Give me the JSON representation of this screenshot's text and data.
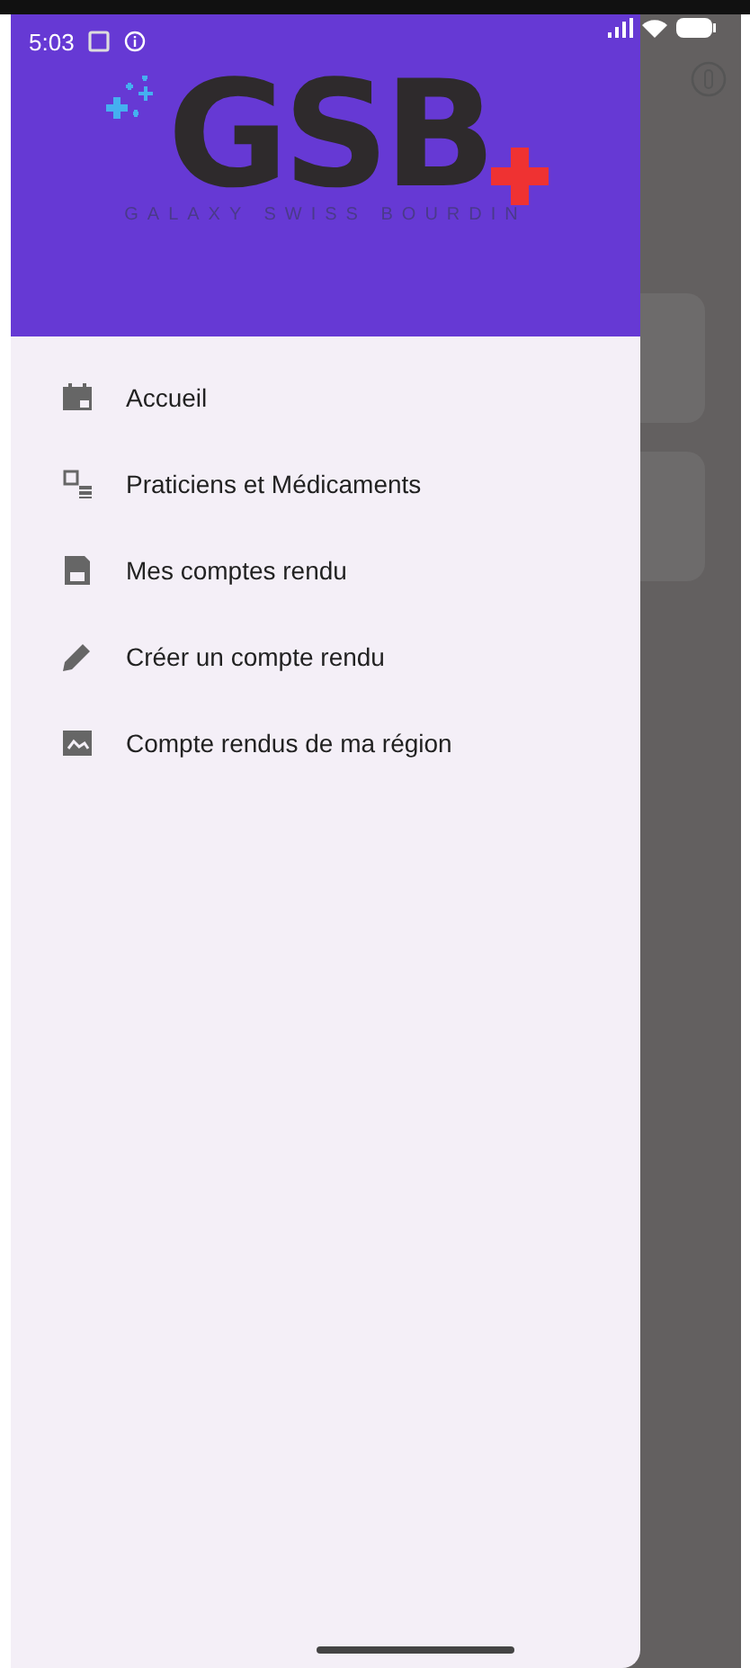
{
  "status_bar": {
    "time": "5:03"
  },
  "header": {
    "logo": "GSB",
    "tagline": "GALAXY SWISS BOURDIN"
  },
  "menu": [
    {
      "label": "Accueil"
    },
    {
      "label": "Praticiens et Médicaments"
    },
    {
      "label": "Mes comptes rendu"
    },
    {
      "label": "Créer un compte rendu"
    },
    {
      "label": "Compte rendus de ma région"
    }
  ]
}
